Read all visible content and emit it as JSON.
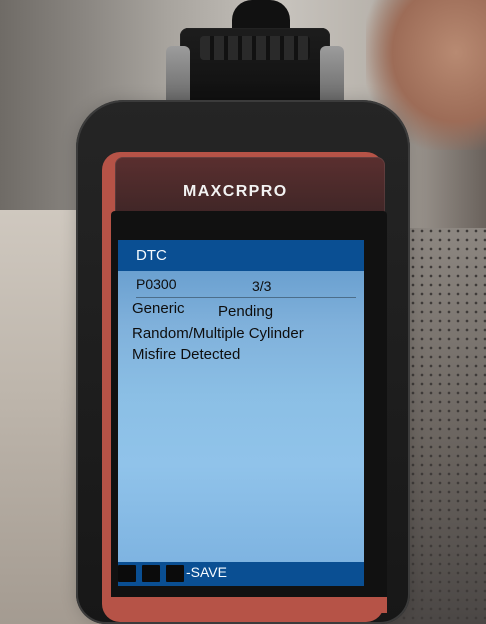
{
  "device": {
    "brand_logo": "MAXCRPRO"
  },
  "screen": {
    "header_title": "DTC",
    "dtc_code": "P0300",
    "dtc_count": "3/3",
    "line1_left": "Generic",
    "line1_right": "Pending",
    "line2": "Random/Multiple Cylinder",
    "line3": "Misfire Detected",
    "save_label": "-SAVE"
  },
  "colors": {
    "device_body": "#252525",
    "device_accent": "#b65347",
    "screen_header": "#0a4f93",
    "screen_background": "#8bbfe5"
  }
}
